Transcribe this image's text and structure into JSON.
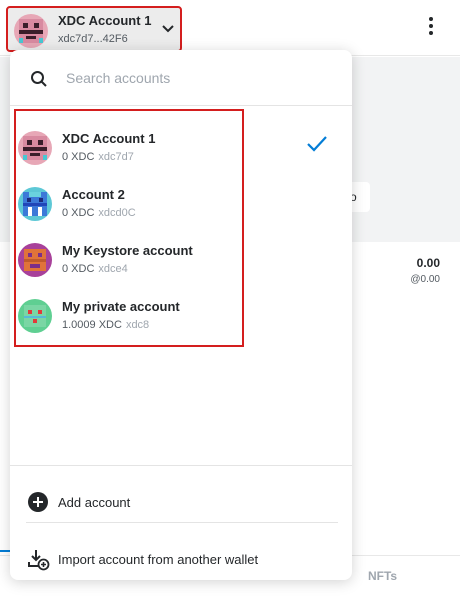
{
  "header": {
    "account_name": "XDC Account 1",
    "account_address": "xdc7d7...42F6",
    "avatar_icon": "pixel-avatar-pink",
    "dropdown_icon": "chevron-down-icon",
    "menu_icon": "kebab-menu-icon"
  },
  "background": {
    "button_fragment": "o",
    "token_value": "0.00",
    "token_fiat": "@0.00",
    "tab_nfts": "NFTs"
  },
  "menu": {
    "search": {
      "placeholder": "Search accounts",
      "value": "",
      "icon": "search-icon"
    },
    "accounts": [
      {
        "name": "XDC Account 1",
        "balance": "0 XDC",
        "short_address": "xdc7d7",
        "selected": true,
        "avatar": "pixel-avatar-pink"
      },
      {
        "name": "Account 2",
        "balance": "0 XDC",
        "short_address": "xdcd0C",
        "selected": false,
        "avatar": "pixel-avatar-blue"
      },
      {
        "name": "My Keystore account",
        "balance": "0 XDC",
        "short_address": "xdce4",
        "selected": false,
        "avatar": "pixel-avatar-orange"
      },
      {
        "name": "My private account",
        "balance": "1.0009 XDC",
        "short_address": "xdc8",
        "selected": false,
        "avatar": "pixel-avatar-green"
      }
    ],
    "selected_icon": "check-icon",
    "actions": [
      {
        "label": "Add account",
        "icon": "plus-circle-icon"
      },
      {
        "label": "Import account from another wallet",
        "icon": "import-icon"
      }
    ]
  },
  "colors": {
    "accent": "#037dd6",
    "highlight_border": "#d41e1e",
    "text": "#24272a",
    "muted": "#535a61"
  }
}
